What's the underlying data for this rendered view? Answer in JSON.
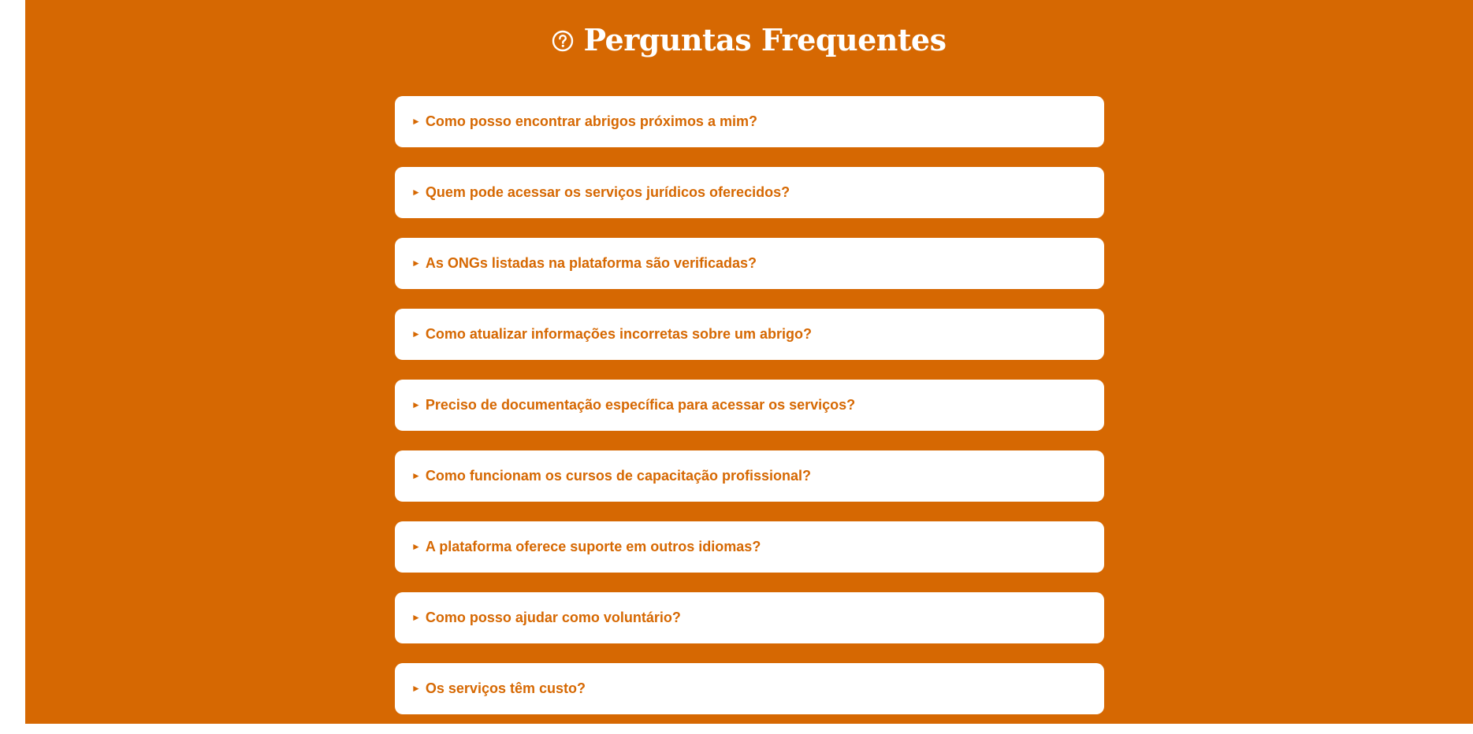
{
  "colors": {
    "accent": "#d66802",
    "card_background": "#ffffff",
    "page_margin": "#ffffff"
  },
  "faq": {
    "title": "Perguntas Frequentes",
    "title_icon": "question-circle-icon",
    "item_icon": "caret-right-icon",
    "items": [
      {
        "question": "Como posso encontrar abrigos próximos a mim?",
        "expanded": false
      },
      {
        "question": "Quem pode acessar os serviços jurídicos oferecidos?",
        "expanded": false
      },
      {
        "question": "As ONGs listadas na plataforma são verificadas?",
        "expanded": false
      },
      {
        "question": "Como atualizar informações incorretas sobre um abrigo?",
        "expanded": false
      },
      {
        "question": "Preciso de documentação específica para acessar os serviços?",
        "expanded": false
      },
      {
        "question": "Como funcionam os cursos de capacitação profissional?",
        "expanded": false
      },
      {
        "question": "A plataforma oferece suporte em outros idiomas?",
        "expanded": false
      },
      {
        "question": "Como posso ajudar como voluntário?",
        "expanded": false
      },
      {
        "question": "Os serviços têm custo?",
        "expanded": false
      }
    ]
  }
}
